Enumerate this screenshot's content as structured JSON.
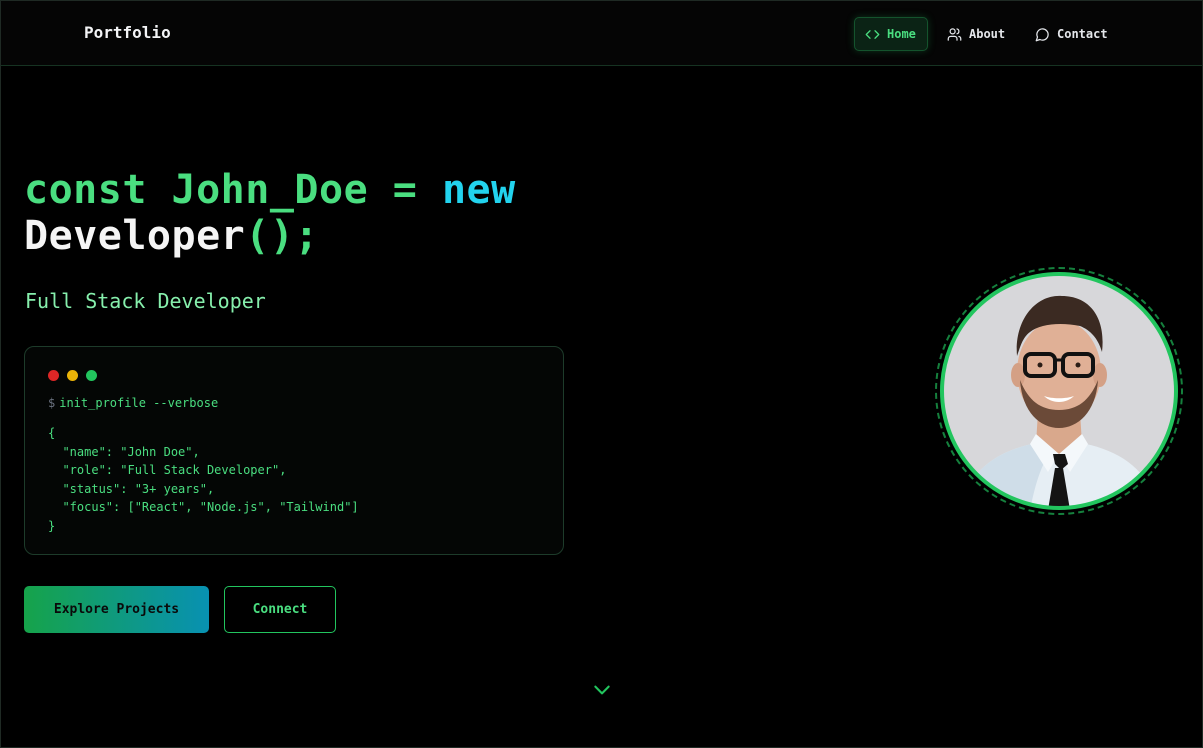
{
  "nav": {
    "brand": "Portfolio",
    "items": [
      {
        "label": "Home",
        "icon": "code-icon",
        "active": true
      },
      {
        "label": "About",
        "icon": "users-icon"
      },
      {
        "label": "Contact",
        "icon": "message-circle-icon"
      }
    ]
  },
  "hero": {
    "title_parts": {
      "keyword": "const",
      "name": "John_Doe",
      "equals": "=",
      "new_kw": "new",
      "class_name": "Developer",
      "parens": "()",
      "semicolon": ";"
    },
    "subtitle": "Full Stack Developer"
  },
  "terminal": {
    "prompt": "$",
    "command": "init_profile --verbose",
    "json_lines": [
      "{",
      "  \"name\": \"John Doe\",",
      "  \"role\": \"Full Stack Developer\",",
      "  \"status\": \"3+ years\",",
      "  \"focus\": [\"React\", \"Node.js\", \"Tailwind\"]",
      "}"
    ]
  },
  "buttons": {
    "primary": "Explore Projects",
    "secondary": "Connect"
  },
  "colors": {
    "accent": "#22c55e",
    "accent_light": "#4ade80",
    "cyan": "#22d3ee",
    "background": "#000000"
  },
  "icons": {
    "scroll_hint": "chevron-down-icon"
  }
}
